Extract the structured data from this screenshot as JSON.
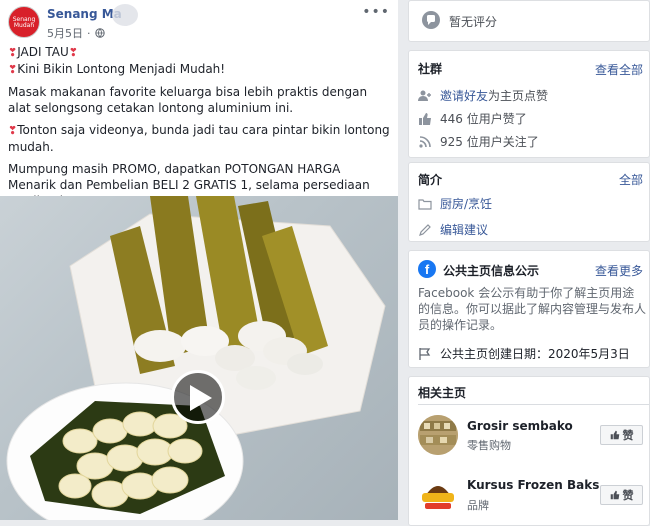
{
  "post": {
    "page_name": "Senang Ma",
    "avatar_text": "Senang Mudah",
    "date": "5月5日",
    "more_icon": "ellipsis-icon",
    "line1": "JADI TAU",
    "line2": "Kini Bikin Lontong Menjadi Mudah!",
    "para1": "Masak makanan favorite keluarga bisa lebih praktis dengan alat selongsong cetakan lontong aluminium ini.",
    "para2": "Tonton saja videonya, bunda jadi tau cara pintar bikin lontong mudah.",
    "para3": "Mumpung masih PROMO, dapatkan POTONGAN HARGA Menarik dan Pembelian BELI 2 GRATIS 1, selama persediaan masih ada."
  },
  "rating": {
    "text": "暂无评分"
  },
  "community": {
    "title": "社群",
    "see_all": "查看全部",
    "invite_link": "邀请好友",
    "invite_suffix": "为主页点赞",
    "likes": "446 位用户赞了",
    "follows": "925 位用户关注了"
  },
  "about": {
    "title": "简介",
    "see_all": "全部",
    "category": "厨房/烹饪",
    "suggest_edit": "编辑建议"
  },
  "transparency": {
    "title": "公共主页信息公示",
    "see_more": "查看更多",
    "description": "Facebook 会公示有助于你了解主页用途的信息。你可以据此了解内容管理与发布人员的操作记录。",
    "created": "公共主页创建日期：2020年5月3日"
  },
  "related": {
    "title": "相关主页",
    "pages": [
      {
        "name": "Grosir sembako",
        "category": "零售购物",
        "like_label": "赞"
      },
      {
        "name": "Kursus Frozen Baks...",
        "category": "品牌",
        "like_label": "赞"
      }
    ]
  },
  "colors": {
    "link": "#385898",
    "brand_red": "#d8202a",
    "facebook_blue": "#1877f2"
  }
}
